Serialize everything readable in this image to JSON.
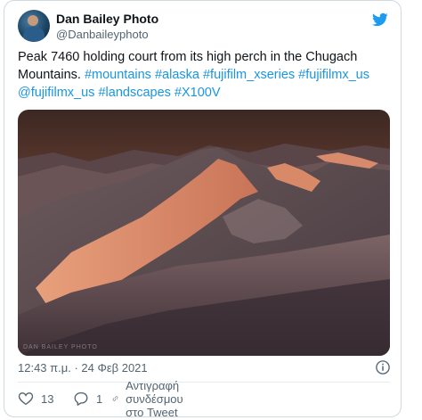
{
  "tweet": {
    "display_name": "Dan Bailey Photo",
    "handle": "@Danbaileyphoto",
    "text_segments": [
      {
        "text": "Peak 7460 holding court from its high perch in the Chugach Mountains. ",
        "kind": "text"
      },
      {
        "text": "#mountains",
        "kind": "tag"
      },
      {
        "text": " ",
        "kind": "text"
      },
      {
        "text": "#alaska",
        "kind": "tag"
      },
      {
        "text": " ",
        "kind": "text"
      },
      {
        "text": "#fujifilm_xseries",
        "kind": "tag"
      },
      {
        "text": " ",
        "kind": "text"
      },
      {
        "text": "#fujifilmx_us",
        "kind": "tag"
      },
      {
        "text": " ",
        "kind": "text"
      },
      {
        "text": "@fujifilmx_us",
        "kind": "tag"
      },
      {
        "text": " ",
        "kind": "text"
      },
      {
        "text": "#landscapes",
        "kind": "tag"
      },
      {
        "text": " ",
        "kind": "text"
      },
      {
        "text": "#X100V",
        "kind": "tag"
      }
    ],
    "media": {
      "watermark": "DAN BAILEY PHOTO"
    },
    "timestamp": "12:43 π.μ. · 24 Φεβ 2021",
    "likes_count": "13",
    "replies_count": "1",
    "copy_link_label": "Αντιγραφή συνδέσμου στο Tweet"
  },
  "icons": {
    "brand": "twitter-bird-icon",
    "info": "info-icon",
    "like": "heart-icon",
    "reply": "comment-icon",
    "copy_link": "link-icon"
  },
  "colors": {
    "link": "#1b95e0",
    "brand": "#1d9bf0",
    "text_primary": "#0f1419",
    "text_secondary": "#536471",
    "border": "#cfd9de"
  }
}
